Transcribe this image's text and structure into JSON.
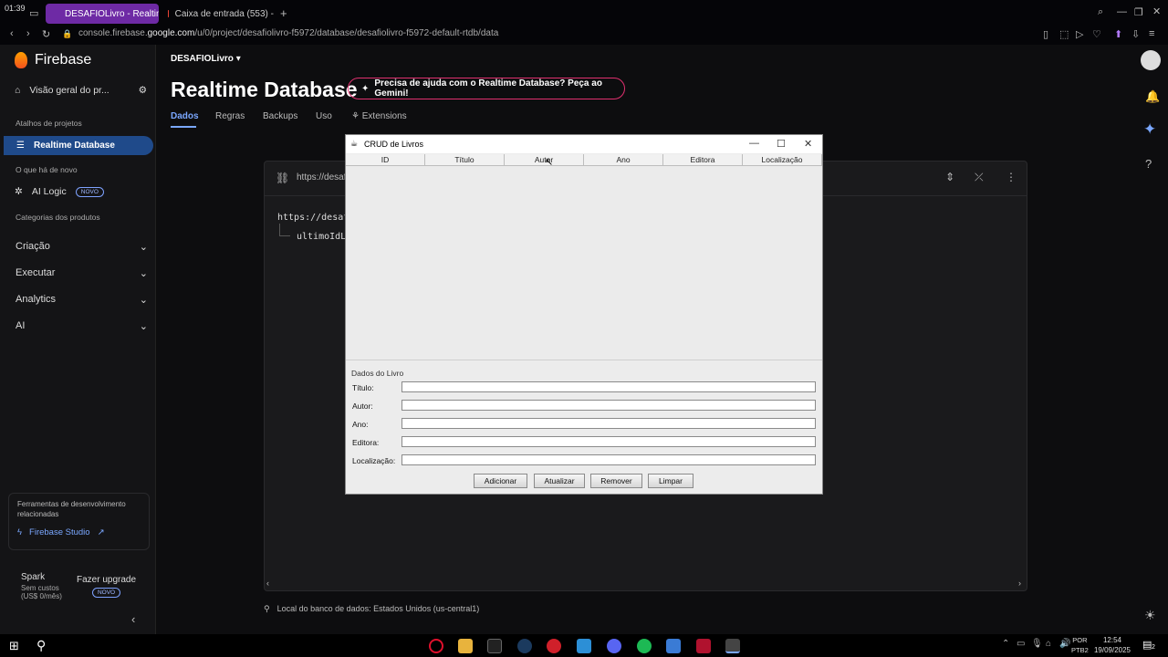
{
  "system": {
    "time_top_left": "01:39"
  },
  "browser": {
    "tabs": [
      {
        "label": "DESAFIOLivro - Realtime",
        "active": true
      },
      {
        "label": "Caixa de entrada (553) -",
        "active": false
      }
    ],
    "url_prefix": "console.firebase.",
    "url_domain": "google.com",
    "url_path": "/u/0/project/desafiolivro-f5972/database/desafiolivro-f5972-default-rtdb/data"
  },
  "sidebar": {
    "brand": "Firebase",
    "overview": "Visão geral do pr...",
    "shortcuts_head": "Atalhos de projetos",
    "active_item": "Realtime Database",
    "whats_new_head": "O que há de novo",
    "ai_logic": "AI Logic",
    "ai_logic_badge": "NOVO",
    "categories_head": "Categorias dos produtos",
    "sections": [
      "Criação",
      "Executar",
      "Analytics",
      "AI"
    ],
    "tools_text": "Ferramentas de desenvolvimento relacionadas",
    "studio_link": "Firebase Studio",
    "plan_name": "Spark",
    "plan_cost_1": "Sem custos",
    "plan_cost_2": "(US$ 0/mês)",
    "upgrade": "Fazer upgrade",
    "upgrade_badge": "NOVO"
  },
  "main": {
    "project": "DESAFIOLivro",
    "title": "Realtime Database",
    "gemini_prompt": "Precisa de ajuda com o Realtime Database? Peça ao Gemini!",
    "tabs": [
      "Dados",
      "Regras",
      "Backups",
      "Uso",
      "Extensions"
    ],
    "panel_url": "https://desaf",
    "tree_root": "https://desafi",
    "tree_child": "ultimoIdLi",
    "db_location": "Local do banco de dados: Estados Unidos (us-central1)"
  },
  "swing": {
    "title": "CRUD de Livros",
    "columns": [
      "ID",
      "Título",
      "Autor",
      "Ano",
      "Editora",
      "Localização"
    ],
    "form_title": "Dados do Livro",
    "fields": [
      {
        "label": "Título:",
        "value": ""
      },
      {
        "label": "Autor:",
        "value": ""
      },
      {
        "label": "Ano:",
        "value": ""
      },
      {
        "label": "Editora:",
        "value": ""
      },
      {
        "label": "Localização:",
        "value": ""
      }
    ],
    "buttons": [
      "Adicionar",
      "Atualizar",
      "Remover",
      "Limpar"
    ]
  },
  "taskbar": {
    "lang_1": "POR",
    "lang_2": "PTB2",
    "clock": "12:54",
    "date": "19/09/2025",
    "notif_count": "2"
  },
  "colors": {
    "accent": "#7aa7ff",
    "active_tab": "#6e2aa5",
    "gemini_border": "#e0306f",
    "sidebar_active": "#1f4a8a"
  }
}
